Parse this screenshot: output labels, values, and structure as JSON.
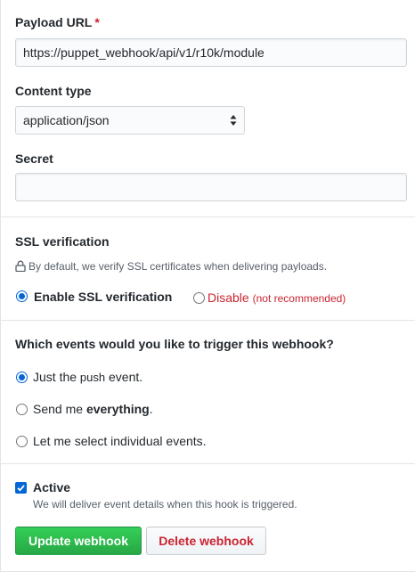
{
  "payload_url": {
    "label": "Payload URL",
    "required_marker": "*",
    "value": "https://puppet_webhook/api/v1/r10k/module"
  },
  "content_type": {
    "label": "Content type",
    "selected": "application/json"
  },
  "secret": {
    "label": "Secret",
    "value": ""
  },
  "ssl": {
    "heading": "SSL verification",
    "note": "By default, we verify SSL certificates when delivering payloads.",
    "enable_label": "Enable SSL verification",
    "disable_label": "Disable",
    "disable_hint": "(not recommended)",
    "selected": "enable"
  },
  "events": {
    "heading": "Which events would you like to trigger this webhook?",
    "options": {
      "push": {
        "prefix": "Just the ",
        "keyword": "push",
        "suffix": " event."
      },
      "everything": {
        "prefix": "Send me ",
        "keyword": "everything",
        "suffix": "."
      },
      "individual": {
        "label": "Let me select individual events."
      }
    },
    "selected": "push"
  },
  "active": {
    "label": "Active",
    "checked": true,
    "note": "We will deliver event details when this hook is triggered."
  },
  "buttons": {
    "update": "Update webhook",
    "delete": "Delete webhook"
  },
  "colors": {
    "accent": "#0366d6",
    "danger": "#cb2431",
    "primary_button": "#28a745"
  },
  "icons": {
    "ssl_note": "lock-icon",
    "select": "select-caret-icon",
    "active": "checkmark-icon"
  }
}
